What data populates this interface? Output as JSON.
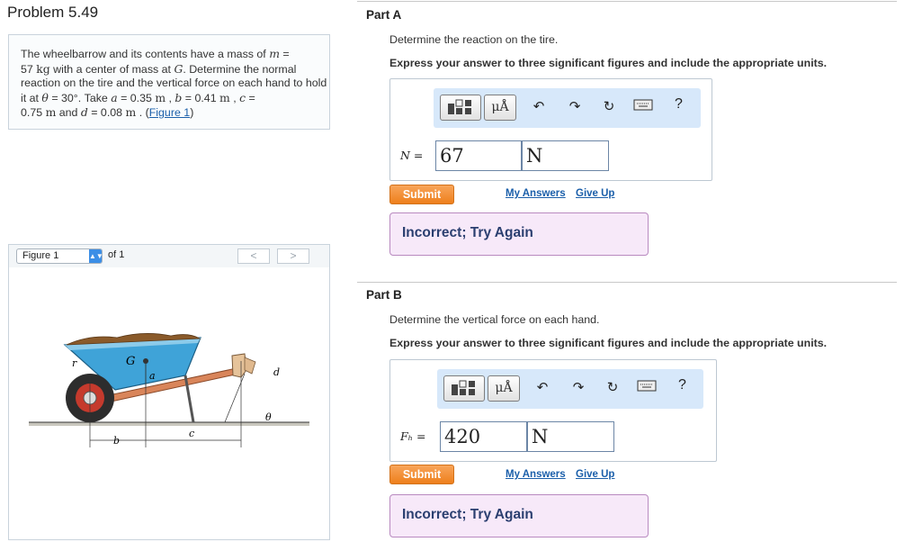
{
  "problem": {
    "title": "Problem 5.49",
    "text_1": "The wheelbarrow and its contents have a mass of ",
    "m_var": "m",
    "text_2": " = ",
    "mass_value": "57",
    "mass_unit": "kg",
    "text_3": " with a center of mass at ",
    "g_var": "G",
    "text_4": ". Determine the normal reaction on the tire and the vertical force on each hand to hold it at ",
    "theta_var": "θ",
    "text_5": " = 30°",
    "text_6": ". Take ",
    "a_var": "a",
    "a_eq": " = 0.35 ",
    "unit_m": "m",
    "sep": " , ",
    "b_var": "b",
    "b_eq": " = 0.41 ",
    "c_var": "c",
    "c_eq": " = ",
    "c_value": "0.75 ",
    "text_and": " and ",
    "d_var": "d",
    "d_eq": " = 0.08 ",
    "text_end": " . (",
    "figure_link": "Figure 1",
    "close": ")"
  },
  "figure_nav": {
    "selected": "Figure 1",
    "of_label": "of 1",
    "prev": "<",
    "next": ">"
  },
  "figure_labels": {
    "r": "r",
    "G": "G",
    "a": "a",
    "d": "d",
    "theta": "θ",
    "b": "b",
    "c": "c"
  },
  "part_a": {
    "title": "Part A",
    "question": "Determine the reaction on the tire.",
    "instruction": "Express your answer to three significant figures and include the appropriate units.",
    "var_label": "N =",
    "value": "67",
    "unit": "N",
    "submit": "Submit",
    "my_answers": "My Answers",
    "give_up": "Give Up",
    "feedback": "Incorrect; Try Again"
  },
  "part_b": {
    "title": "Part B",
    "question": "Determine the vertical force on each hand.",
    "instruction": "Express your answer to three significant figures and include the appropriate units.",
    "var_label": "Fₕ =",
    "value": "420",
    "unit": "N",
    "submit": "Submit",
    "my_answers": "My Answers",
    "give_up": "Give Up",
    "feedback": "Incorrect; Try Again"
  },
  "toolbar": {
    "mu_label": "μÅ",
    "help": "?",
    "icons": [
      "templates-icon",
      "units-icon",
      "undo-icon",
      "redo-icon",
      "reset-icon",
      "keyboard-icon",
      "help-icon"
    ]
  },
  "colors": {
    "link": "#1b5faa",
    "submit": "#ee7f1c",
    "toolbar_bg": "#d7e8fa",
    "feedback_bg": "#f7e9f9"
  }
}
